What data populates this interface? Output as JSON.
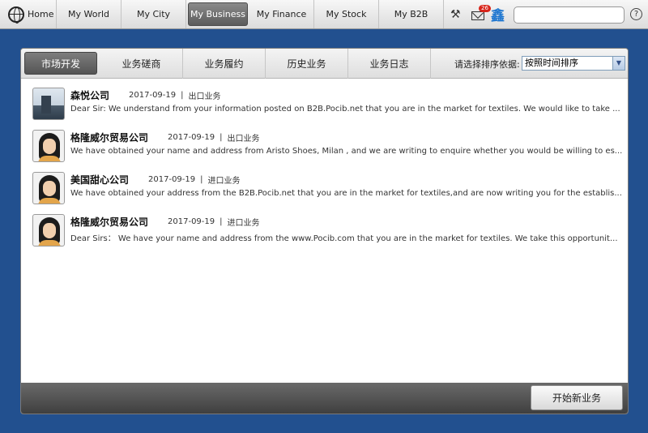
{
  "nav": {
    "home": "Home",
    "items": [
      "My World",
      "My City",
      "My Business",
      "My Finance",
      "My Stock",
      "My B2B"
    ],
    "active": "My Business",
    "mail_count": "26",
    "xin_glyph": "鑫",
    "help_glyph": "?"
  },
  "tabs": [
    "市场开发",
    "业务磋商",
    "业务履约",
    "历史业务",
    "业务日志"
  ],
  "sort": {
    "label": "请选择排序依据:",
    "selected": "按照时间排序"
  },
  "items": [
    {
      "company": "森悦公司",
      "date": "2017-09-19",
      "sep": "|",
      "type": "出口业务",
      "preview": "Dear Sir: We understand from your information posted on B2B.Pocib.net that you are in the market for textiles. We would like to take ...",
      "avatar": "building-photo"
    },
    {
      "company": "格隆威尔贸易公司",
      "date": "2017-09-19",
      "sep": "|",
      "type": "出口业务",
      "preview": "We have obtained your name and address from Aristo Shoes, Milan , and we are writing to enquire whether you would be willing to es...",
      "avatar": "woman-portrait"
    },
    {
      "company": "美国甜心公司",
      "date": "2017-09-19",
      "sep": "|",
      "type": "进口业务",
      "preview": "We have obtained your address from the B2B.Pocib.net that you are in the market for textiles,and are now writing you for the establis...",
      "avatar": "woman-portrait"
    },
    {
      "company": "格隆威尔贸易公司",
      "date": "2017-09-19",
      "sep": "|",
      "type": "进口业务",
      "preview": "Dear Sirs： We have your name and address from the www.Pocib.com that you are in the market for textiles. We take this opportunit...",
      "avatar": "woman-portrait"
    }
  ],
  "new_button": "开始新业务",
  "colors": {
    "background": "#22508f",
    "active_tab": "#5c5c5c",
    "mail_badge": "#d8261c",
    "xin": "#1f77d0"
  }
}
